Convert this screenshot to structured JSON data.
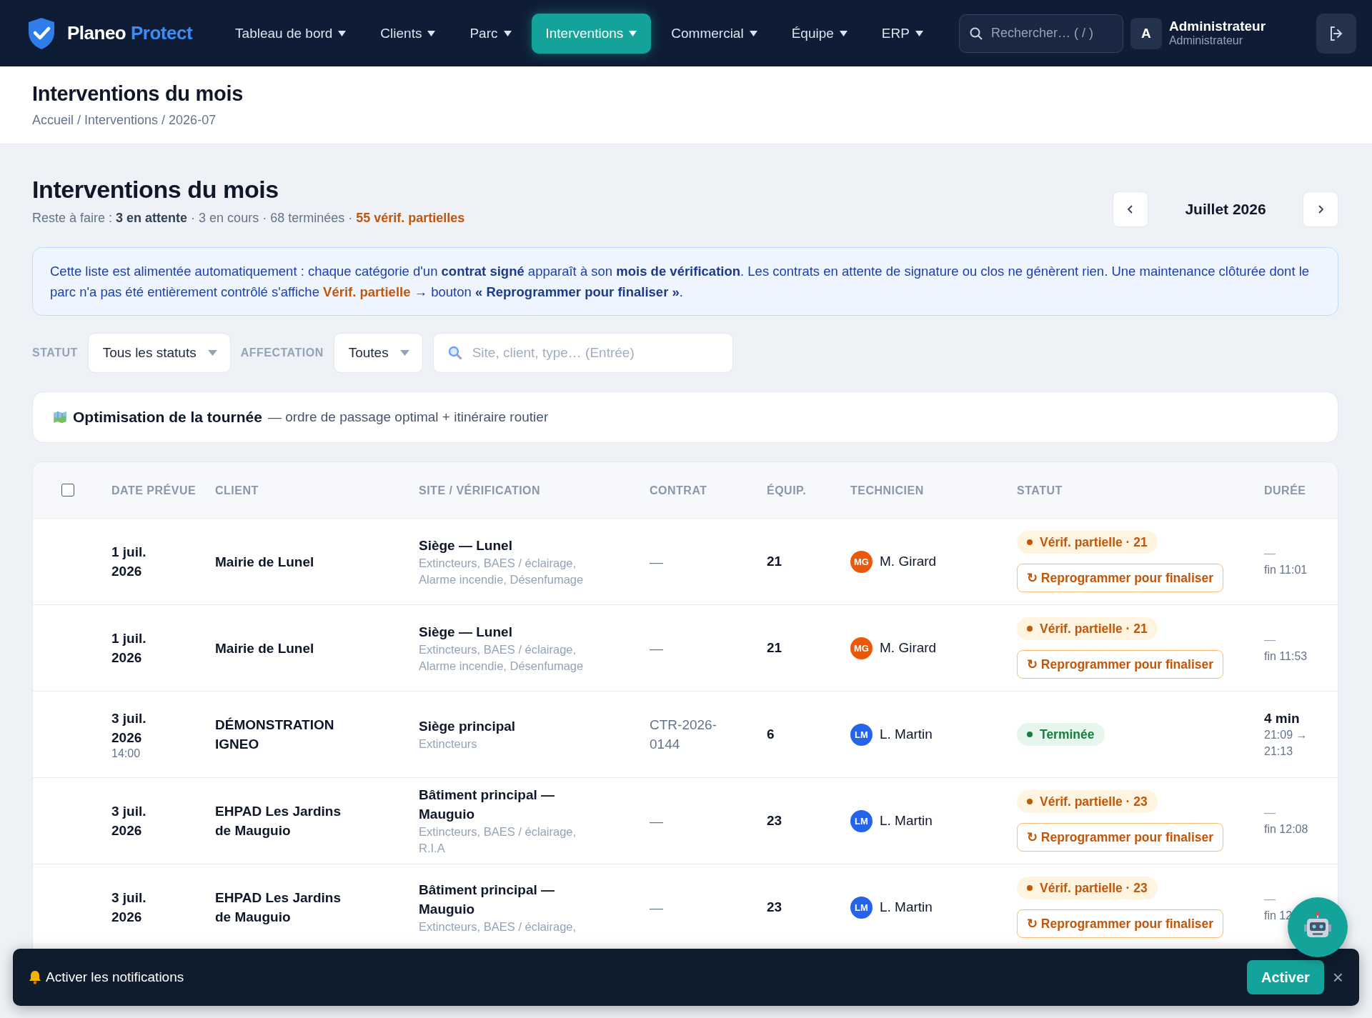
{
  "brand": {
    "name": "Planeo",
    "accent": "Protect"
  },
  "nav": [
    {
      "label": "Tableau de bord",
      "selected": false
    },
    {
      "label": "Clients",
      "selected": false
    },
    {
      "label": "Parc",
      "selected": false
    },
    {
      "label": "Interventions",
      "selected": true
    },
    {
      "label": "Commercial",
      "selected": false
    },
    {
      "label": "Équipe",
      "selected": false
    },
    {
      "label": "ERP",
      "selected": false
    }
  ],
  "search": {
    "placeholder": "Rechercher… ( / )"
  },
  "user": {
    "initial": "A",
    "name": "Administrateur",
    "role": "Administrateur"
  },
  "page_header": {
    "title": "Interventions du mois",
    "breadcrumb": "Accueil / Interventions / 2026-07"
  },
  "section": {
    "title": "Interventions du mois",
    "summary": "Reste à faire : **3 en attente** · 3 en cours · 68 terminées · ",
    "summary_alert": "55 vérif. partielles",
    "month": "Juillet 2026"
  },
  "info": [
    {
      "kind": "plain",
      "text": "Cette liste est alimentée automatiquement : chaque catégorie d'un "
    },
    {
      "kind": "strong",
      "text": "contrat signé"
    },
    {
      "kind": "plain",
      "text": " apparaît à son "
    },
    {
      "kind": "strong",
      "text": "mois de vérification"
    },
    {
      "kind": "plain",
      "text": ". Les contrats en attente de signature ou clos ne génèrent rien. Une maintenance clôturée dont le parc n'a pas été entièrement contrôlé s'affiche "
    },
    {
      "kind": "warn",
      "text": "Vérif. partielle"
    },
    {
      "kind": "strong",
      "text": " → "
    },
    {
      "kind": "plain",
      "text": "bouton "
    },
    {
      "kind": "strong",
      "text": "« Reprogrammer pour finaliser »"
    },
    {
      "kind": "plain",
      "text": "."
    }
  ],
  "filters": [
    {
      "kind": "select",
      "label": "STATUT",
      "value": "Tous les statuts"
    },
    {
      "kind": "select",
      "label": "AFFECTATION",
      "value": "Toutes"
    },
    {
      "kind": "search",
      "placeholder": "Site, client, type… (Entrée)"
    }
  ],
  "optimisation": {
    "title": "Optimisation de la tournée",
    "description": "— ordre de passage optimal + itinéraire routier"
  },
  "table": {
    "select_all": {
      "checked": false
    },
    "columns": [
      "DATE PRÉVUE",
      "CLIENT",
      "SITE / VÉRIFICATION",
      "CONTRAT",
      "ÉQUIP.",
      "TECHNICIEN",
      "STATUT",
      "DURÉE"
    ],
    "rows": [
      {
        "date": "1 juil. 2026",
        "client": "Mairie de Lunel",
        "site": "Siège — Lunel",
        "categories": "Extincteurs, BAES / éclairage, Alarme incendie, Désenfumage",
        "contract": "—",
        "equipment": "21",
        "technician": {
          "initials": "MG",
          "name": "M. Girard",
          "color": "#ea580c"
        },
        "status": {
          "kind": "partial",
          "label": "Vérif. partielle · 21"
        },
        "action": "↻ Reprogrammer pour finaliser",
        "duration": "—",
        "end": "fin 11:01"
      },
      {
        "date": "1 juil. 2026",
        "client": "Mairie de Lunel",
        "site": "Siège — Lunel",
        "categories": "Extincteurs, BAES / éclairage, Alarme incendie, Désenfumage",
        "contract": "—",
        "equipment": "21",
        "technician": {
          "initials": "MG",
          "name": "M. Girard",
          "color": "#ea580c"
        },
        "status": {
          "kind": "partial",
          "label": "Vérif. partielle · 21"
        },
        "action": "↻ Reprogrammer pour finaliser",
        "duration": "—",
        "end": "fin 11:53"
      },
      {
        "date": "3 juil. 2026",
        "time": "14:00",
        "client": "DÉMONSTRATION IGNEO",
        "site": "Siège principal",
        "categories": "Extincteurs",
        "contract": "CTR-2026-0144",
        "equipment": "6",
        "technician": {
          "initials": "LM",
          "name": "L. Martin",
          "color": "#2563eb"
        },
        "status": {
          "kind": "done",
          "label": "Terminée"
        },
        "duration": "4 min",
        "end": "21:09 → 21:13"
      },
      {
        "date": "3 juil. 2026",
        "client": "EHPAD Les Jardins de Mauguio",
        "site": "Bâtiment principal — Mauguio",
        "categories": "Extincteurs, BAES / éclairage, R.I.A",
        "contract": "—",
        "equipment": "23",
        "technician": {
          "initials": "LM",
          "name": "L. Martin",
          "color": "#2563eb"
        },
        "status": {
          "kind": "partial",
          "label": "Vérif. partielle · 23"
        },
        "action": "↻ Reprogrammer pour finaliser",
        "duration": "—",
        "end": "fin 12:08"
      },
      {
        "date": "3 juil. 2026",
        "client": "EHPAD Les Jardins de Mauguio",
        "site": "Bâtiment principal — Mauguio",
        "categories": "Extincteurs, BAES / éclairage,",
        "contract": "—",
        "equipment": "23",
        "technician": {
          "initials": "LM",
          "name": "L. Martin",
          "color": "#2563eb"
        },
        "status": {
          "kind": "partial",
          "label": "Vérif. partielle · 23"
        },
        "action": "↻ Reprogrammer pour finaliser",
        "duration": "—",
        "end": "fin 12"
      }
    ]
  },
  "notification": {
    "message": "Activer les notifications",
    "button": "Activer",
    "close": "×"
  }
}
